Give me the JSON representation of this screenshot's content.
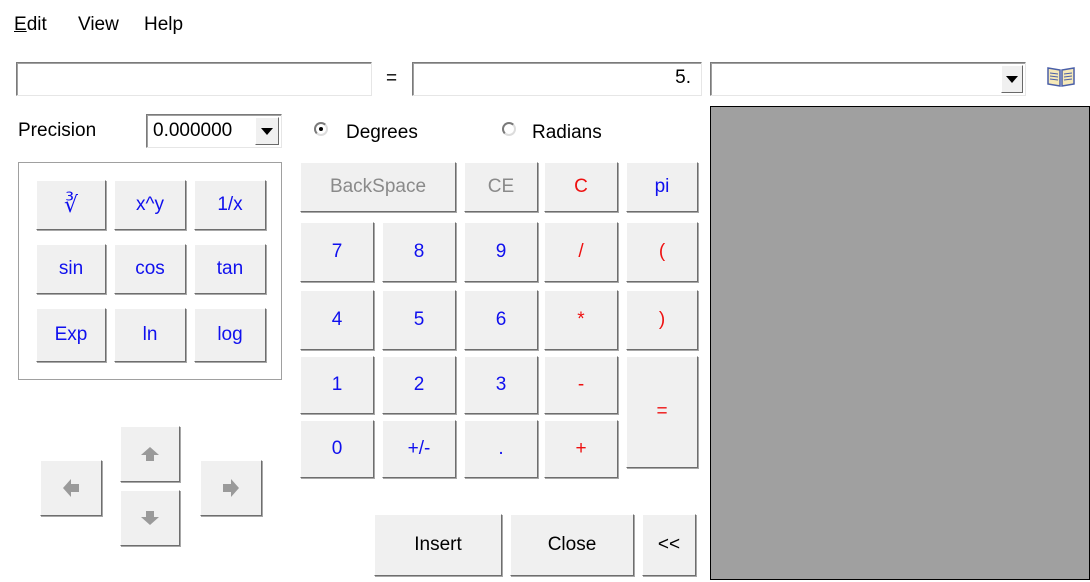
{
  "menu": {
    "edit": {
      "accel": "E",
      "rest": "dit"
    },
    "view": "View",
    "help": "Help"
  },
  "expression": {
    "value": ""
  },
  "equals_label": "=",
  "result": {
    "value": "5."
  },
  "history_combo": {
    "value": ""
  },
  "precision": {
    "label": "Precision",
    "value": "0.000000"
  },
  "angle_mode": {
    "degrees_label": "Degrees",
    "radians_label": "Radians",
    "selected": "Degrees"
  },
  "functions": {
    "root": "∛",
    "power": "x^y",
    "reciprocal": "1/x",
    "sin": "sin",
    "cos": "cos",
    "tan": "tan",
    "exp": "Exp",
    "ln": "ln",
    "log": "log"
  },
  "keys": {
    "backspace": "BackSpace",
    "ce": "CE",
    "c": "C",
    "pi": "pi",
    "d7": "7",
    "d8": "8",
    "d9": "9",
    "div": "/",
    "lparen": "(",
    "d4": "4",
    "d5": "5",
    "d6": "6",
    "mul": "*",
    "rparen": ")",
    "d1": "1",
    "d2": "2",
    "d3": "3",
    "sub": "-",
    "d0": "0",
    "neg": "+/-",
    "dot": ".",
    "add": "+",
    "equals": "="
  },
  "actions": {
    "insert": "Insert",
    "close": "Close",
    "collapse": "<<"
  },
  "icons": {
    "book": "book-icon",
    "up": "arrow-up-icon",
    "down": "arrow-down-icon",
    "left": "arrow-left-icon",
    "right": "arrow-right-icon"
  },
  "colors": {
    "function_key": "#1010ee",
    "clear_key": "#ee1010",
    "panel_bg": "#a0a0a0"
  }
}
